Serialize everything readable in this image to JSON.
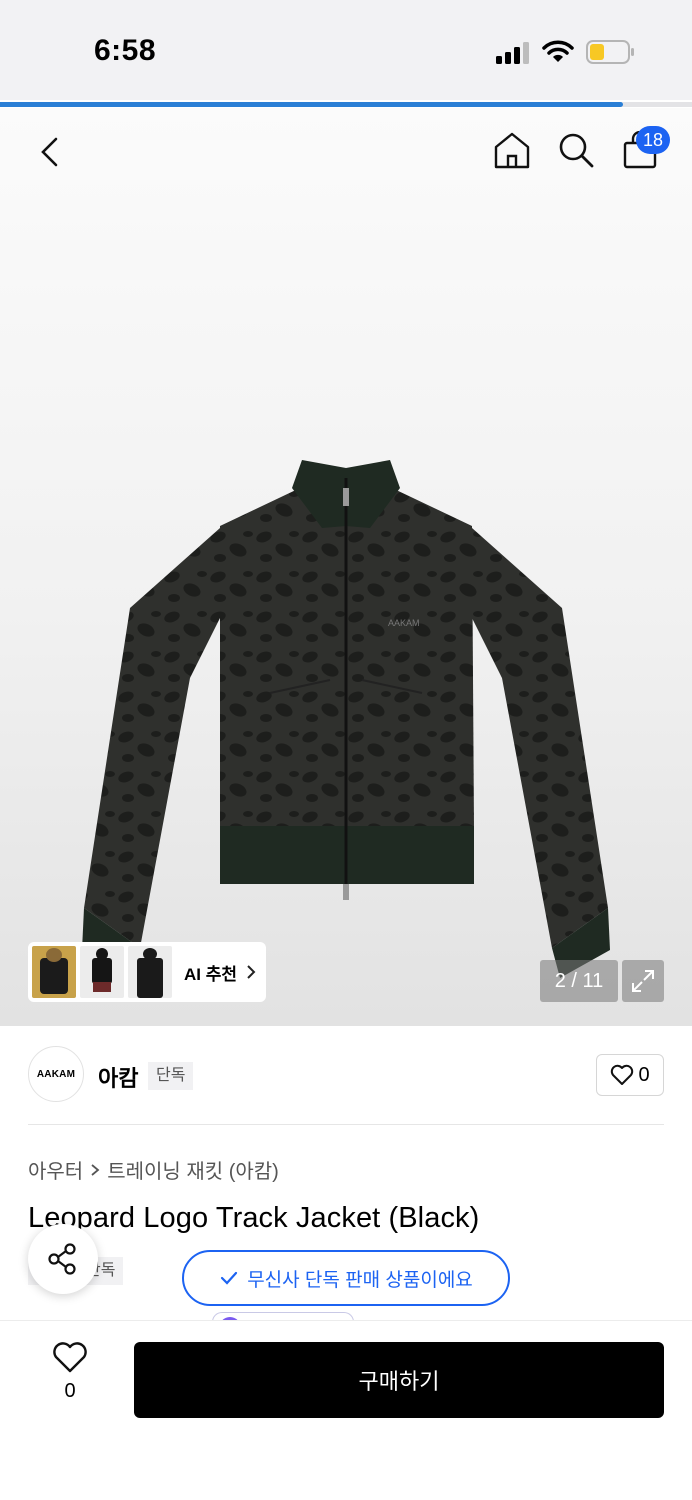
{
  "status_bar": {
    "time": "6:58"
  },
  "page_progress": 0.9,
  "header": {
    "cart_count": "18"
  },
  "gallery": {
    "ai_recommend_label": "AI 추천",
    "page_counter": "2 / 11",
    "jacket_print": "AAKAM"
  },
  "brand": {
    "logo_text": "AAKAM",
    "name": "아캄",
    "exclusive_tag": "단독",
    "like_count": "0"
  },
  "product": {
    "breadcrumb": [
      "아우터",
      "트레이닝 재킷 (아캄)"
    ],
    "title": "Leopard Logo Track Jacket (Black)",
    "exclusive_tag": "단독",
    "exclusive_notice": "무신사 단독 판매 상품이에요"
  },
  "bottom_bar": {
    "wishlist_count": "0",
    "buy_label": "구매하기"
  },
  "colors": {
    "accent": "#1c63f2",
    "progress": "#2a7fd6",
    "buy_button": "#000000"
  }
}
